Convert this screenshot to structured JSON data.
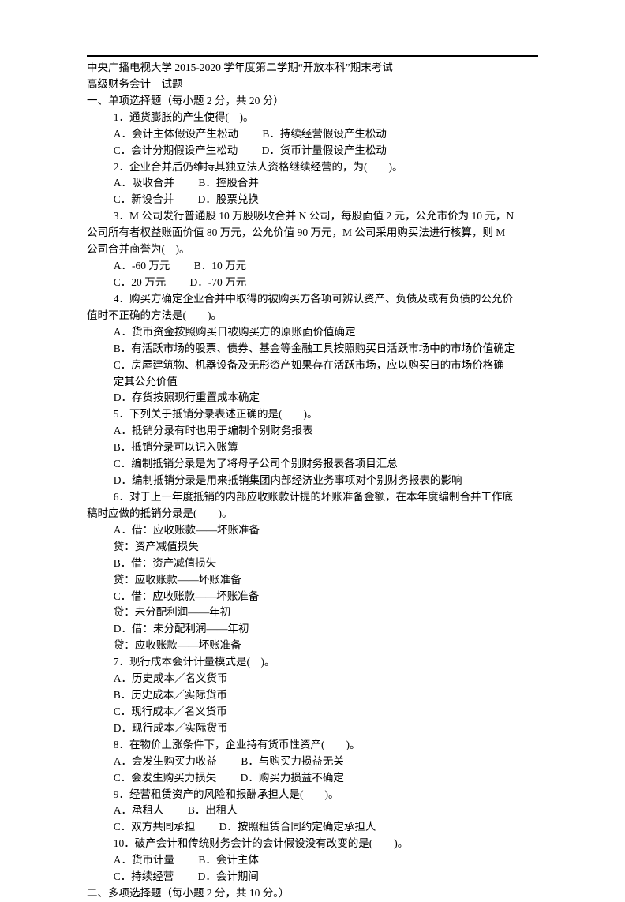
{
  "header": {
    "line1": "中央广播电视大学 2015-2020 学年度第二学期“开放本科”期末考试",
    "line2": "高级财务会计　试题"
  },
  "sections": {
    "s1": {
      "title": "一、单项选择题（每小题 2 分，共 20 分）",
      "q1": {
        "stem": "1．通货膨胀的产生使得(　)。",
        "a": "A．会计主体假设产生松动",
        "b": "B．持续经营假设产生松动",
        "c": "C．会计分期假设产生松动",
        "d": "D．货币计量假设产生松动"
      },
      "q2": {
        "stem": "2．企业合并后仍维持其独立法人资格继续经营的，为(　　)。",
        "a": "A．吸收合并",
        "b": "B．控股合并",
        "c": "C．新设合并",
        "d": "D．股票兑换"
      },
      "q3": {
        "l1": "3．M 公司发行普通股 10 万股吸收合并 N 公司，每股面值 2 元，公允市价为 10 元，N",
        "l2": "公司所有者权益账面价值 80 万元，公允价值 90 万元，M 公司采用购买法进行核算，则 M",
        "l3": "公司合并商誉为(　)。",
        "a": "A．-60 万元",
        "b": "B．10 万元",
        "c": "C．20 万元",
        "d": "D．-70 万元"
      },
      "q4": {
        "l1": "4．购买方确定企业合并中取得的被购买方各项可辨认资产、负债及或有负债的公允价",
        "l2": "值时不正确的方法是(　　)。",
        "a": "A．货币资金按照购买日被购买方的原账面价值确定",
        "b": "B．有活跃市场的股票、债券、基金等金融工具按照购买日活跃市场中的市场价值确定",
        "c1": "C．房屋建筑物、机器设备及无形资产如果存在活跃市场，应以购买日的市场价格确",
        "c2": "定其公允价值",
        "d": "D．存货按照现行重置成本确定"
      },
      "q5": {
        "stem": "5．下列关于抵销分录表述正确的是(　　)。",
        "a": "A．抵销分录有时也用于编制个别财务报表",
        "b": "B．抵销分录可以记入账簿",
        "c": "C．编制抵销分录是为了将母子公司个别财务报表各项目汇总",
        "d": "D．编制抵销分录是用来抵销集团内部经济业务事项对个别财务报表的影响"
      },
      "q6": {
        "l1": "6．对于上一年度抵销的内部应收账款计提的坏账准备金额，在本年度编制合并工作底",
        "l2": "稿时应做的抵销分录是(　　)。",
        "a1": "A．借：应收账款——坏账准备",
        "a2": "贷：资产减值损失",
        "b1": "B．借：资产减值损失",
        "b2": "贷：应收账款——坏账准备",
        "c1": "C．借：应收账款——坏账准备",
        "c2": "贷：未分配利润——年初",
        "d1": "D．借：未分配利润——年初",
        "d2": "贷：应收账款——坏账准备"
      },
      "q7": {
        "stem": "7．现行成本会计计量模式是(　)。",
        "a": "A．历史成本／名义货币",
        "b": "B．历史成本／实际货币",
        "c": "C．现行成本／名义货币",
        "d": "D．现行成本／实际货币"
      },
      "q8": {
        "stem": "8．在物价上涨条件下，企业持有货币性资产(　　)。",
        "a": "A．会发生购买力收益",
        "b": "B．与购买力损益无关",
        "c": "C．会发生购买力损失",
        "d": "D．购买力损益不确定"
      },
      "q9": {
        "stem": "9．经营租赁资产的风险和报酬承担人是(　　)。",
        "a": "A．承租人",
        "b": "B．出租人",
        "c": "C．双方共同承担",
        "d": "D．按照租赁合同约定确定承担人"
      },
      "q10": {
        "stem": "10．破产会计和传统财务会计的会计假设没有改变的是(　　)。",
        "a": "A．货币计量",
        "b": "B．会计主体",
        "c": "C．持续经营",
        "d": "D．会计期间"
      }
    },
    "s2": {
      "title": "二、多项选择题（每小题 2 分，共 10 分。）"
    }
  }
}
